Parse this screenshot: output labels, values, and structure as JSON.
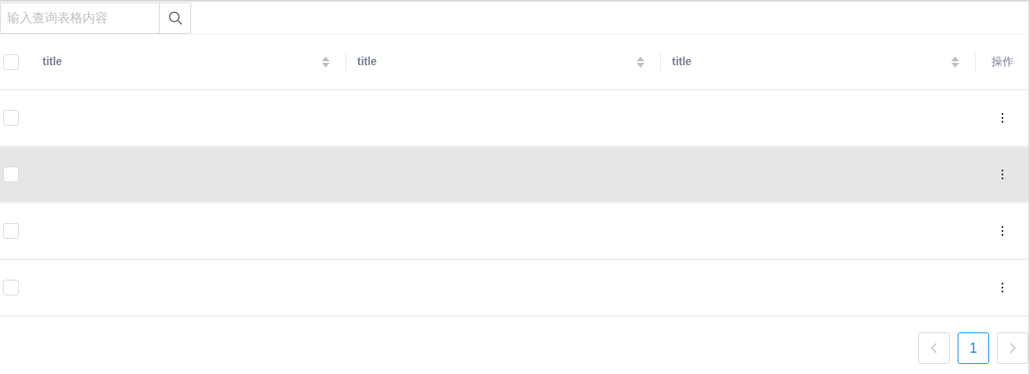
{
  "search": {
    "placeholder": "输入查询表格内容"
  },
  "table": {
    "select_all": {
      "checked": false
    },
    "columns": [
      {
        "label": "title",
        "sortable": true
      },
      {
        "label": "title",
        "sortable": true
      },
      {
        "label": "title",
        "sortable": true
      },
      {
        "label": "操作",
        "sortable": false
      }
    ],
    "rows": [
      {
        "checked": false,
        "hovered": false
      },
      {
        "checked": false,
        "hovered": true
      },
      {
        "checked": false,
        "hovered": false
      },
      {
        "checked": false,
        "hovered": false
      }
    ]
  },
  "pagination": {
    "prev_disabled": true,
    "next_disabled": true,
    "pages": [
      {
        "label": "1",
        "selected": true
      }
    ]
  }
}
